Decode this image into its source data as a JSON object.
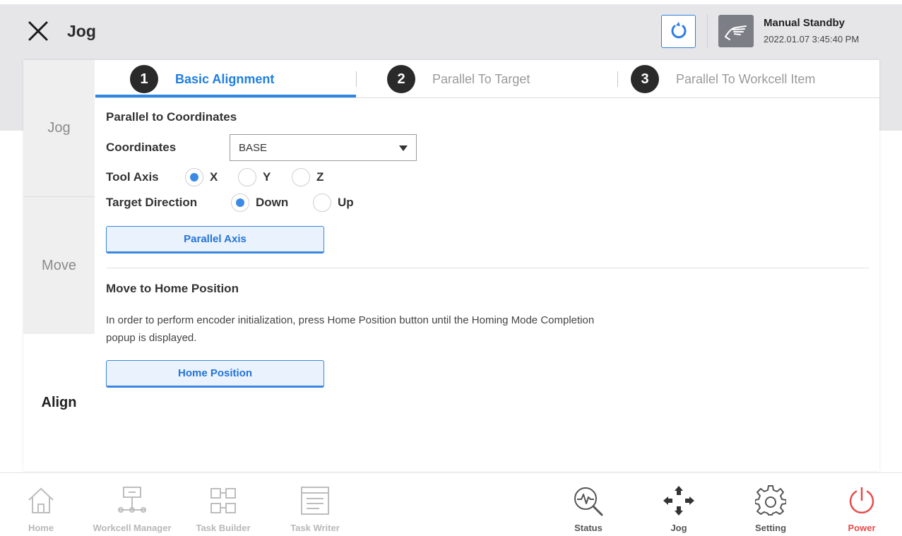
{
  "header": {
    "title": "Jog",
    "status_title": "Manual Standby",
    "status_time": "2022.01.07 3:45:40 PM"
  },
  "side_menu": {
    "items": [
      {
        "label": "Jog",
        "active": false
      },
      {
        "label": "Move",
        "active": false
      },
      {
        "label": "Align",
        "active": true
      }
    ]
  },
  "tabs": [
    {
      "number": "1",
      "label": "Basic Alignment",
      "active": true
    },
    {
      "number": "2",
      "label": "Parallel To Target",
      "active": false
    },
    {
      "number": "3",
      "label": "Parallel To Workcell Item",
      "active": false
    }
  ],
  "parallel": {
    "title": "Parallel to Coordinates",
    "coordinates_label": "Coordinates",
    "coordinates_value": "BASE",
    "tool_axis_label": "Tool Axis",
    "tool_axis_options": [
      "X",
      "Y",
      "Z"
    ],
    "tool_axis_selected": "X",
    "target_direction_label": "Target Direction",
    "target_direction_options": [
      "Down",
      "Up"
    ],
    "target_direction_selected": "Down",
    "button_label": "Parallel Axis"
  },
  "home": {
    "title": "Move to Home Position",
    "description": "In order to perform encoder initialization, press Home Position button until the Homing Mode Completion popup is displayed.",
    "button_label": "Home Position"
  },
  "footer": {
    "items": [
      {
        "label": "Home",
        "icon": "home-icon",
        "enabled": false
      },
      {
        "label": "Workcell Manager",
        "icon": "workcell-manager-icon",
        "enabled": false
      },
      {
        "label": "Task Builder",
        "icon": "task-builder-icon",
        "enabled": false
      },
      {
        "label": "Task Writer",
        "icon": "task-writer-icon",
        "enabled": false
      },
      {
        "label": "Status",
        "icon": "status-icon",
        "enabled": true
      },
      {
        "label": "Jog",
        "icon": "jog-icon",
        "enabled": true
      },
      {
        "label": "Setting",
        "icon": "gear-icon",
        "enabled": true
      },
      {
        "label": "Power",
        "icon": "power-icon",
        "enabled": true
      }
    ]
  },
  "colors": {
    "accent": "#2f87e5",
    "power": "#e84c4c",
    "header_bg": "#e6e6e8"
  }
}
